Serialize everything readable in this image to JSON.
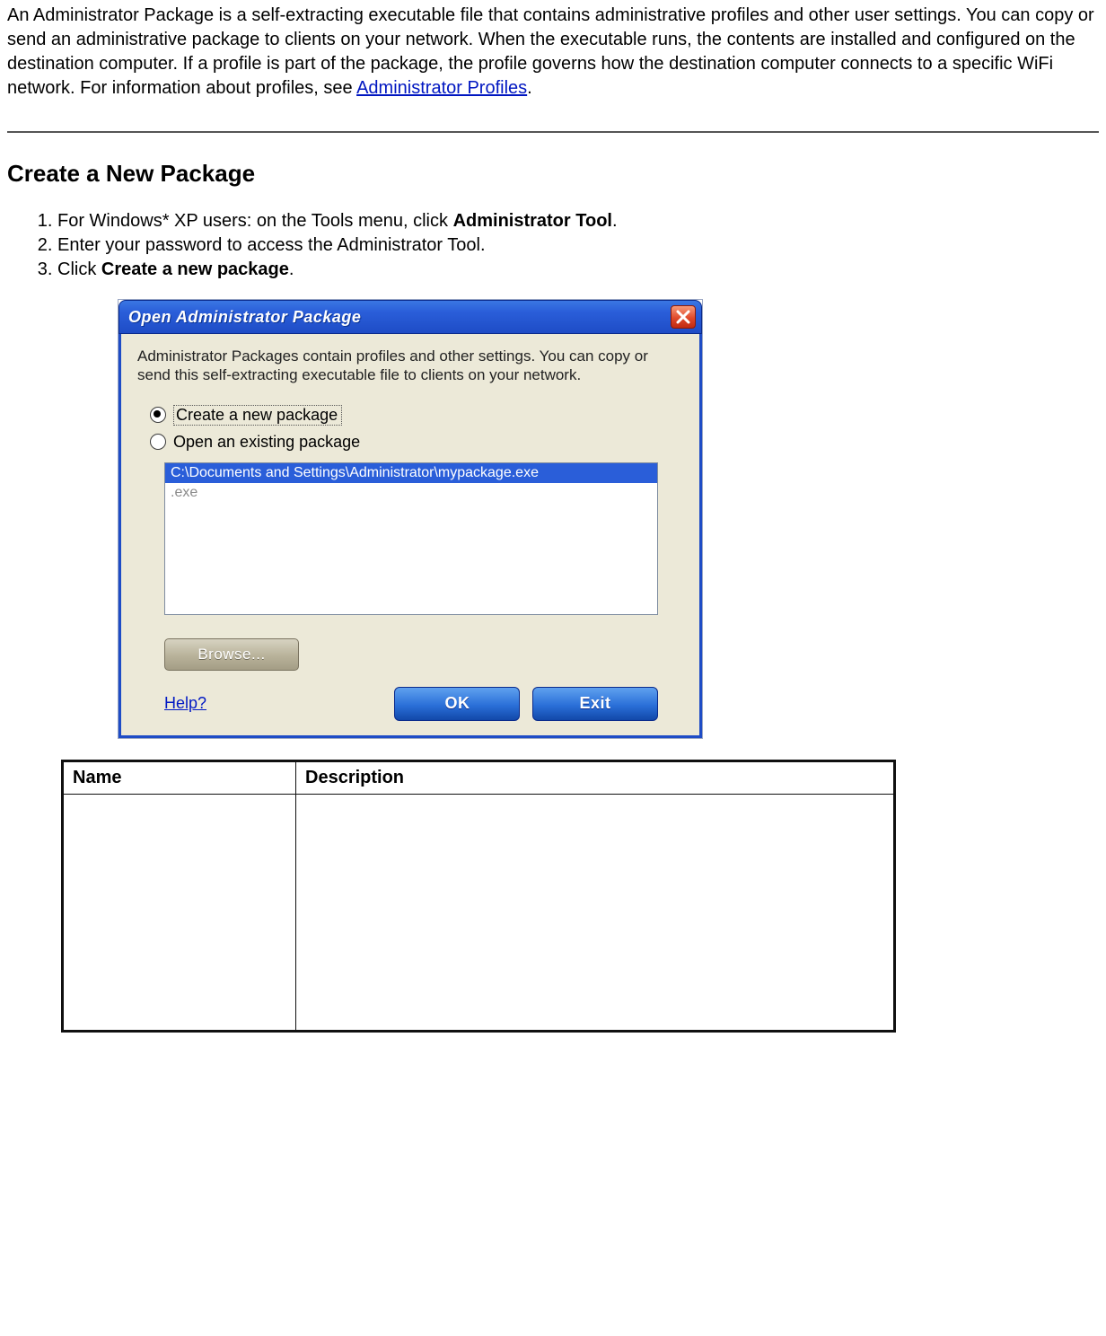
{
  "intro": {
    "text_before_link": "An Administrator Package is a self-extracting executable file that contains administrative profiles and other user settings. You can copy or send an administrative package to clients on your network. When the executable runs, the contents are installed and configured on the destination computer. If a profile is part of the package, the profile governs how the destination computer connects to a specific WiFi network. For information about profiles, see ",
    "link_text": "Administrator Profiles",
    "text_after_link": "."
  },
  "section_heading": "Create a New Package",
  "steps": {
    "s1_prefix": "For Windows* XP users: on the Tools menu, click ",
    "s1_bold": "Administrator Tool",
    "s1_suffix": ".",
    "s2": "Enter your password to access the Administrator Tool.",
    "s3_prefix": "Click ",
    "s3_bold": "Create a new package",
    "s3_suffix": "."
  },
  "dialog": {
    "title": "Open Administrator Package",
    "description": "Administrator Packages contain profiles and other settings. You can copy or send this self-extracting executable file to clients on your network.",
    "radio_create": "Create a new package",
    "radio_open": "Open an existing package",
    "list_selected": "C:\\Documents and Settings\\Administrator\\mypackage.exe",
    "list_dim": ".exe",
    "browse": "Browse...",
    "help": "Help?",
    "ok": "OK",
    "exit": "Exit"
  },
  "table": {
    "col_name": "Name",
    "col_desc": "Description"
  }
}
